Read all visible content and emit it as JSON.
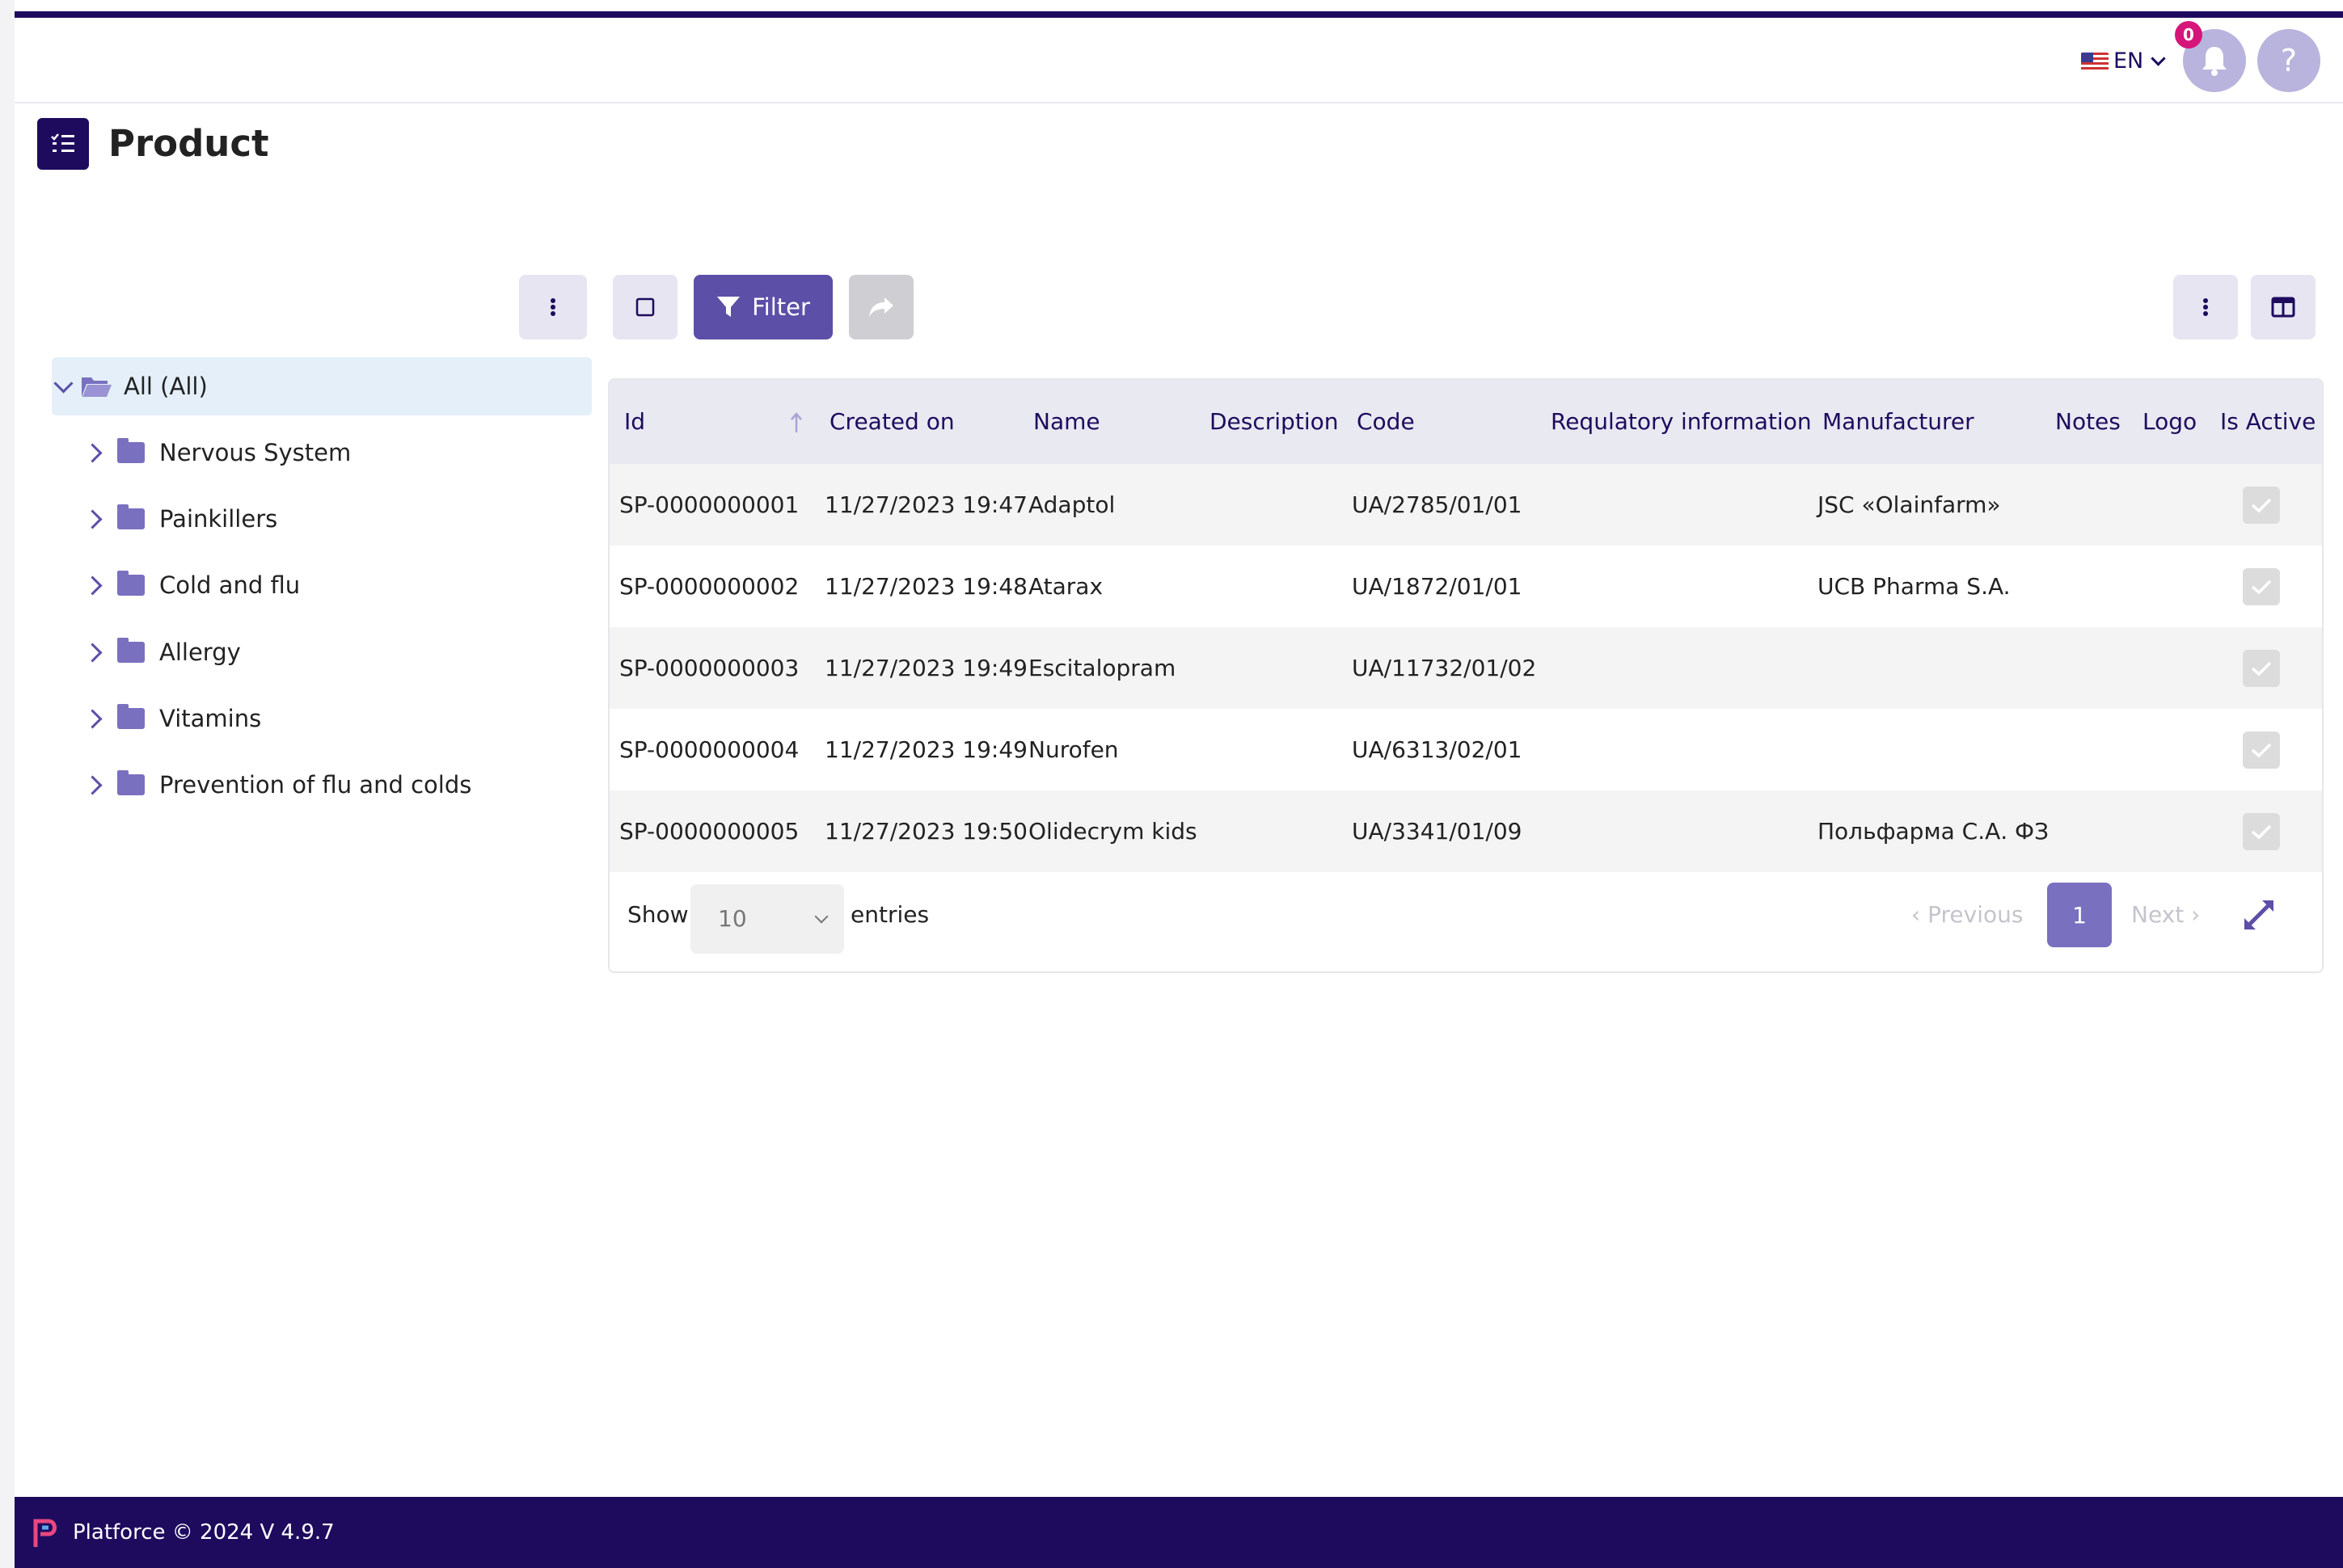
{
  "header": {
    "language": "EN",
    "notification_count": "0",
    "help_glyph": "?"
  },
  "page": {
    "title": "Product"
  },
  "toolbar": {
    "filter_label": "Filter"
  },
  "tree": {
    "root_label": "All (All)",
    "items": [
      {
        "label": "Nervous System"
      },
      {
        "label": "Painkillers"
      },
      {
        "label": "Cold and flu"
      },
      {
        "label": "Allergy"
      },
      {
        "label": "Vitamins"
      },
      {
        "label": "Prevention of flu and colds"
      }
    ]
  },
  "table": {
    "columns": [
      "Id",
      "Created on",
      "Name",
      "Description",
      "Code",
      "Requlatory information",
      "Manufacturer",
      "Notes",
      "Logo",
      "Is Active"
    ],
    "rows": [
      {
        "id": "SP-0000000001",
        "created": "11/27/2023 19:47",
        "name": "Adaptol",
        "code": "UA/2785/01/01",
        "manufacturer": "JSC «Olainfarm»",
        "active": true
      },
      {
        "id": "SP-0000000002",
        "created": "11/27/2023 19:48",
        "name": "Atarax",
        "code": "UA/1872/01/01",
        "manufacturer": "UCB Pharma S.A.",
        "active": true
      },
      {
        "id": "SP-0000000003",
        "created": "11/27/2023 19:49",
        "name": "Escitalopram",
        "code": "UA/11732/01/02",
        "manufacturer": "",
        "active": true
      },
      {
        "id": "SP-0000000004",
        "created": "11/27/2023 19:49",
        "name": "Nurofen",
        "code": "UA/6313/02/01",
        "manufacturer": "",
        "active": true
      },
      {
        "id": "SP-0000000005",
        "created": "11/27/2023 19:50",
        "name": "Olidecrym kids",
        "code": "UA/3341/01/09",
        "manufacturer": "Польфарма С.А. ФЗ",
        "active": true
      }
    ]
  },
  "pagination": {
    "show_label": "Show",
    "page_size": "10",
    "entries_label": "entries",
    "previous_label": "Previous",
    "next_label": "Next",
    "current_page": "1"
  },
  "footer": {
    "text": "Platforce © 2024 V 4.9.7"
  },
  "colors": {
    "brand": "#1e0b5e",
    "accent": "#5b4fa8",
    "badge": "#d6157a"
  }
}
